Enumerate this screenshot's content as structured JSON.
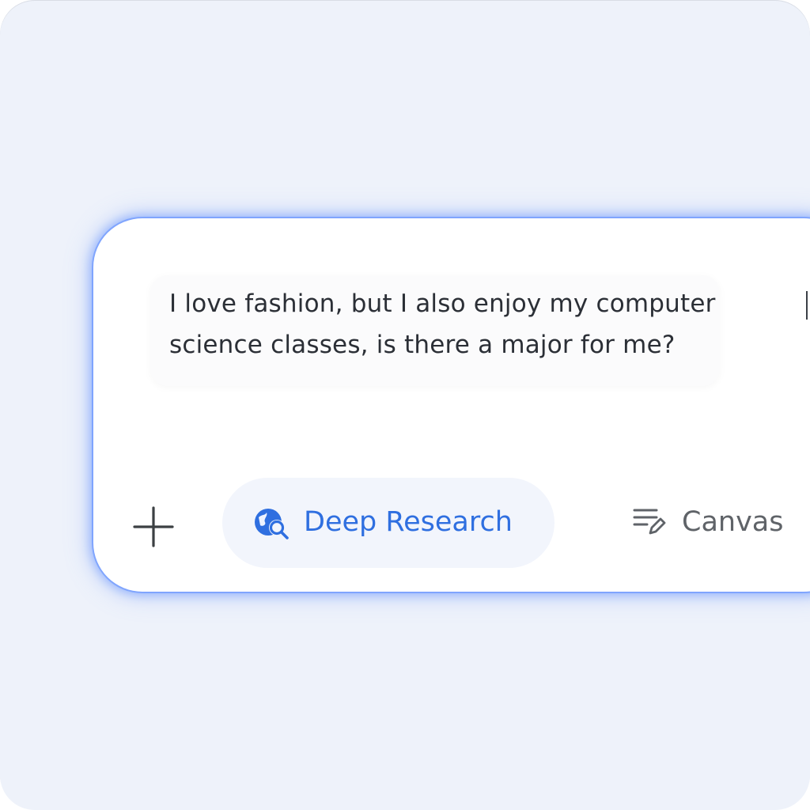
{
  "prompt": {
    "line1": "I love fashion, but I also enjoy my computer",
    "line2": "science classes, is there a major for me?"
  },
  "toolbar": {
    "add_icon": "plus-icon",
    "deep_research": {
      "label": "Deep Research",
      "icon": "globe-search-icon",
      "color": "#2f6fe0",
      "selected": true
    },
    "canvas": {
      "label": "Canvas",
      "icon": "lines-pencil-icon",
      "color": "#5f6368"
    }
  },
  "colors": {
    "background": "#eef2fa",
    "composer_glow": "#5c8cff",
    "text": "#2b2f36"
  }
}
